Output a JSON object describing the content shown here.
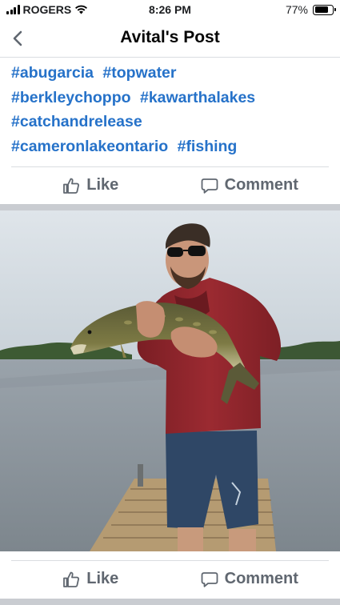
{
  "status_bar": {
    "carrier": "ROGERS",
    "time": "8:26 PM",
    "battery_percent": "77%",
    "battery_level": 0.77
  },
  "header": {
    "title": "Avital's Post",
    "back_icon": "chevron-left-icon"
  },
  "post": {
    "hashtag_lines": [
      [
        "#abugarcia",
        "#topwater"
      ],
      [
        "#berkleychoppo",
        "#kawarthalakes"
      ],
      [
        "#catchandrelease"
      ],
      [
        "#cameronlakeontario",
        "#fishing"
      ]
    ],
    "photo_label": "man holding a large pike on a dock by a lake"
  },
  "actions_top": {
    "like_label": "Like",
    "like_icon": "thumbs-up-icon",
    "comment_label": "Comment",
    "comment_icon": "speech-bubble-icon"
  },
  "actions_bottom": {
    "like_label": "Like",
    "like_icon": "thumbs-up-icon",
    "comment_label": "Comment",
    "comment_icon": "speech-bubble-icon"
  },
  "colors": {
    "hashtag": "#2672c9",
    "action_text": "#606770",
    "divider": "#c9ccd1"
  }
}
